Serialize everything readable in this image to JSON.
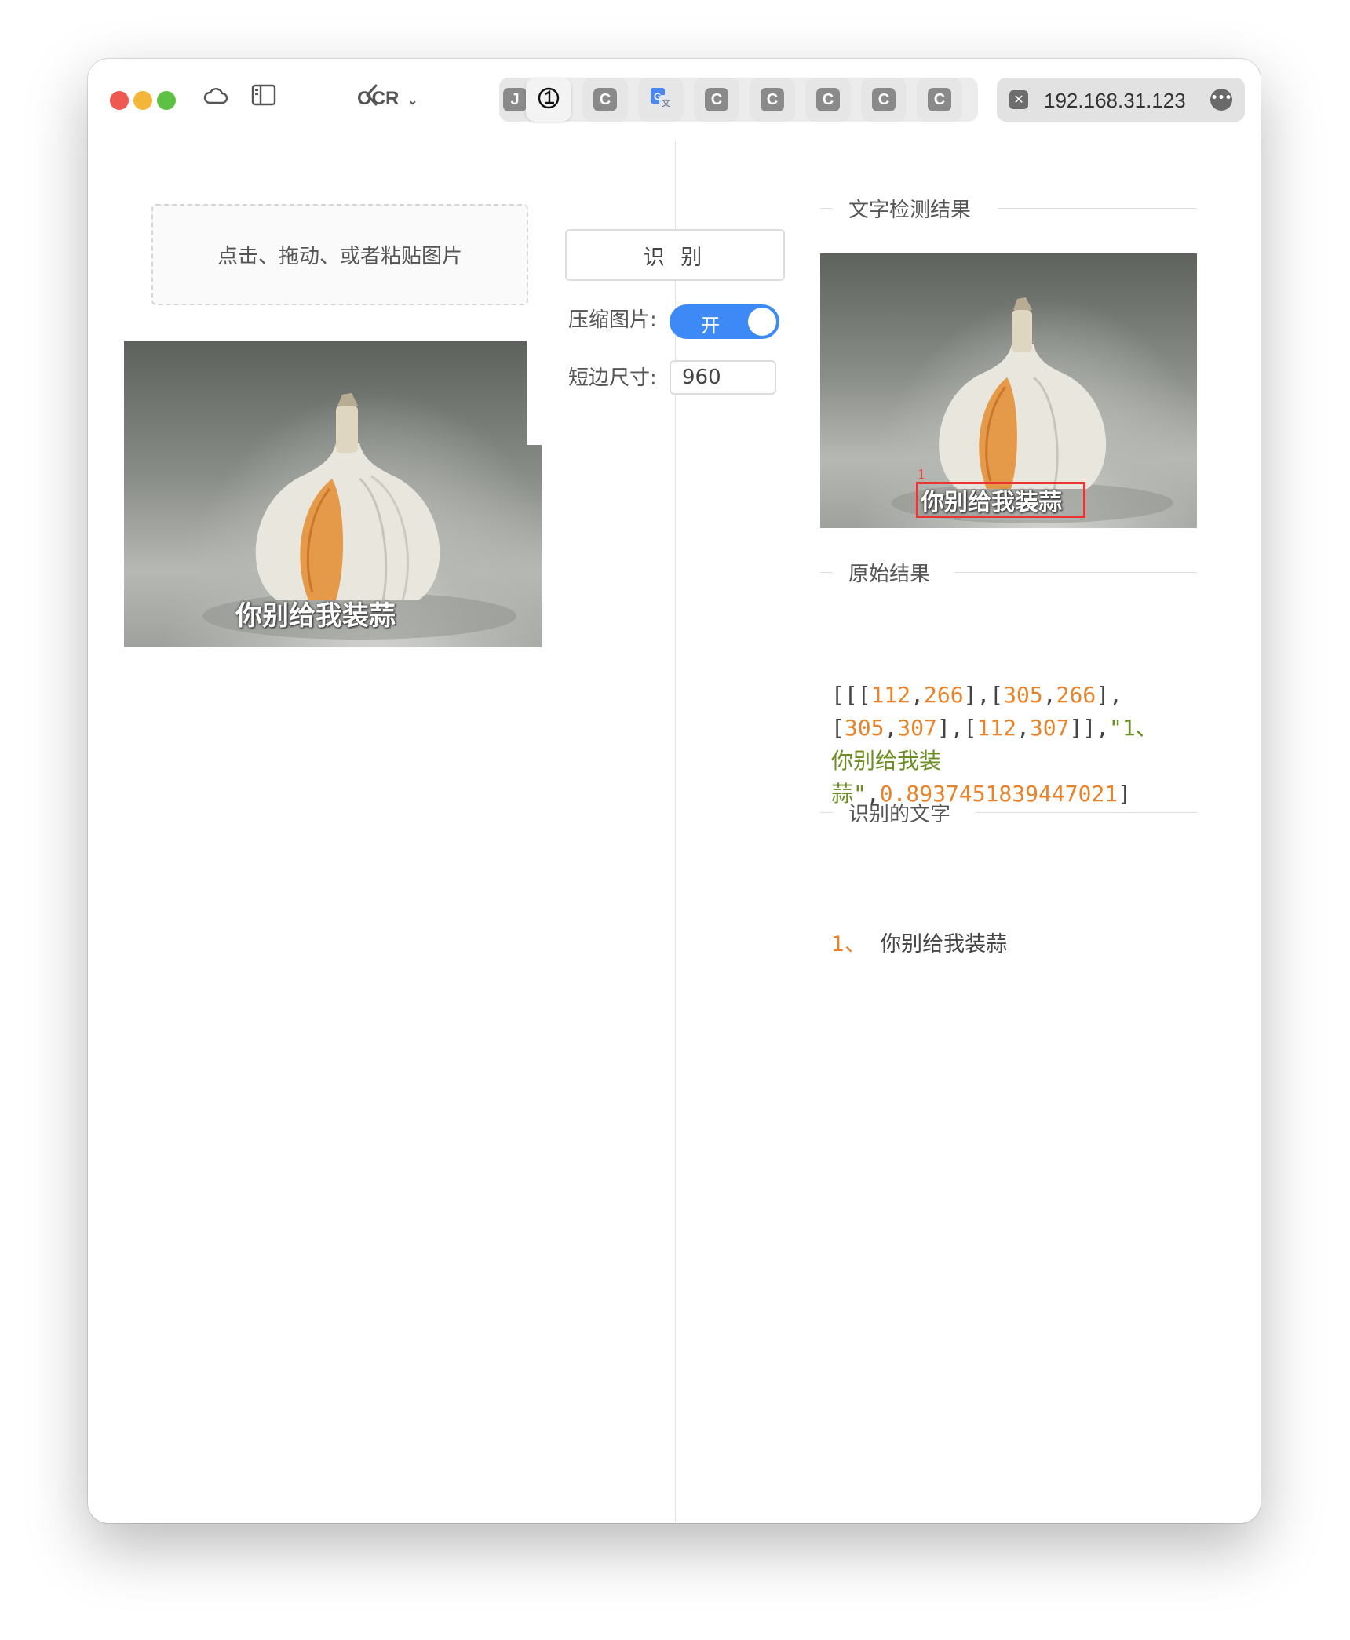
{
  "toolbar": {
    "app_label": "OCR",
    "url": "192.168.31.123",
    "tabs": [
      {
        "glyph": "J",
        "icon": "tab-j-icon"
      },
      {
        "glyph": "",
        "icon": "tab-1-icon"
      },
      {
        "glyph": "C",
        "icon": "tab-c-icon"
      },
      {
        "glyph": "",
        "icon": "google-translate-icon"
      },
      {
        "glyph": "C",
        "icon": "tab-c-icon"
      },
      {
        "glyph": "C",
        "icon": "tab-c-icon"
      },
      {
        "glyph": "C",
        "icon": "tab-c-icon"
      },
      {
        "glyph": "C",
        "icon": "tab-c-icon"
      },
      {
        "glyph": "C",
        "icon": "tab-c-icon"
      }
    ]
  },
  "left": {
    "drop_zone_text": "点击、拖动、或者粘贴图片",
    "recognize_button": "识 别",
    "compress_label": "压缩图片:",
    "compress_state": "开",
    "short_side_label": "短边尺寸:",
    "short_side_value": "960",
    "image_caption": "你别给我装蒜"
  },
  "right": {
    "detect_title": "文字检测结果",
    "detect_box_index": "1",
    "detect_caption": "你别给我装蒜",
    "raw_title": "原始结果",
    "raw_tokens": {
      "open": "[[[",
      "x1": "112",
      "y1": "266",
      "x2": "305",
      "y2": "266",
      "x3": "305",
      "y3": "307",
      "x4": "112",
      "y4": "307",
      "str_a": "\"1、",
      "str_b": "你别给我装",
      "str_c": "蒜\"",
      "score": "0.8937451839447021"
    },
    "text_title": "识别的文字",
    "results": [
      {
        "index": "1、",
        "text": "你别给我装蒜"
      }
    ]
  },
  "colors": {
    "accent": "#3d8af7",
    "number": "#e8832a",
    "string": "#6b8e23",
    "box": "#e33333"
  }
}
